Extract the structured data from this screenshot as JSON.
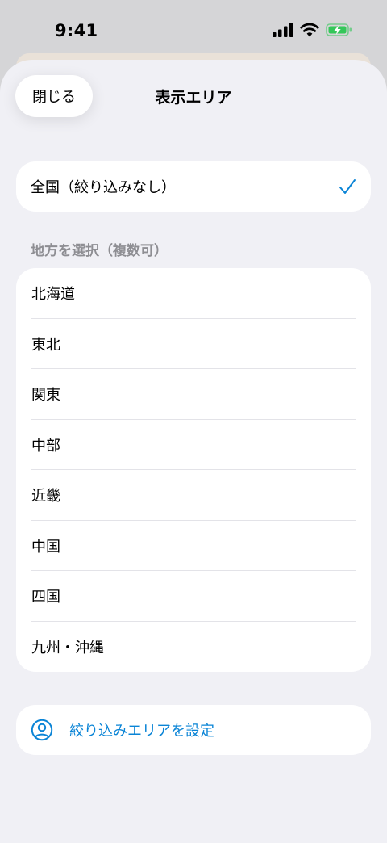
{
  "status_bar": {
    "time": "9:41",
    "battery_color": "#34c759"
  },
  "sheet": {
    "close_label": "閉じる",
    "title": "表示エリア"
  },
  "all_option": {
    "label": "全国（絞り込みなし）",
    "selected": true,
    "check_color": "#0a84d6"
  },
  "regions": {
    "header": "地方を選択（複数可）",
    "items": [
      {
        "label": "北海道"
      },
      {
        "label": "東北"
      },
      {
        "label": "関東"
      },
      {
        "label": "中部"
      },
      {
        "label": "近畿"
      },
      {
        "label": "中国"
      },
      {
        "label": "四国"
      },
      {
        "label": "九州・沖縄"
      }
    ]
  },
  "custom_area": {
    "label": "絞り込みエリアを設定",
    "icon": "person-circle-icon",
    "color": "#0a84d6"
  }
}
